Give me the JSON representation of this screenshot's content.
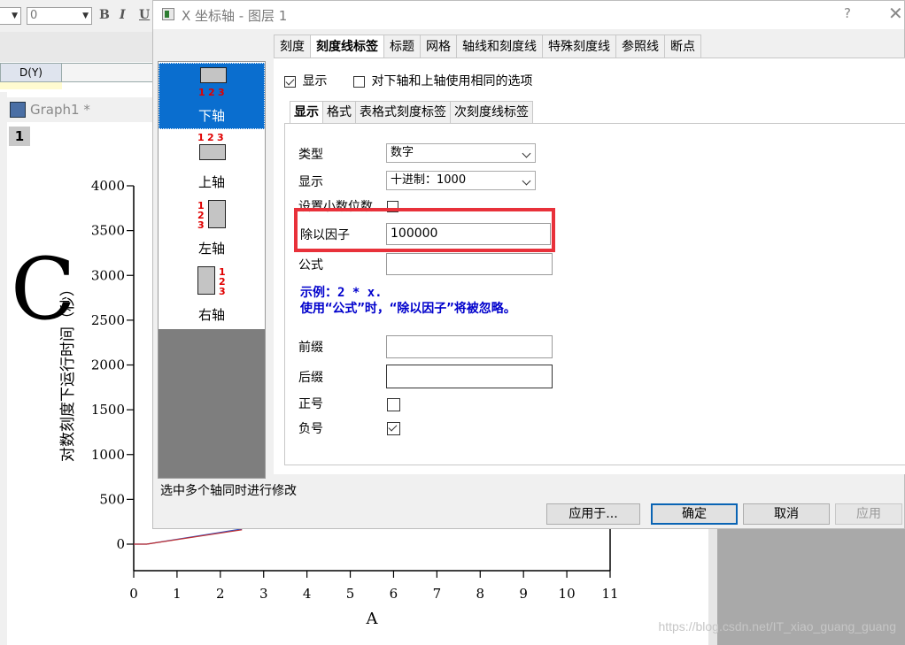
{
  "toolbar": {
    "font_size_value": "0",
    "bold_label": "B",
    "italic_label": "I",
    "underline_label": "U"
  },
  "worksheet": {
    "column_header": "D(Y)"
  },
  "graph_window": {
    "title": "Graph1 *",
    "layer_badge": "1"
  },
  "dialog": {
    "title": "X 坐标轴 - 图层 1",
    "help_label": "?",
    "close_label": "✕",
    "tabs": [
      "刻度",
      "刻度线标签",
      "标题",
      "网格",
      "轴线和刻度线",
      "特殊刻度线",
      "参照线",
      "断点"
    ],
    "active_tab": "刻度线标签",
    "side_items": [
      {
        "label": "下轴",
        "selected": true
      },
      {
        "label": "上轴",
        "selected": false
      },
      {
        "label": "左轴",
        "selected": false
      },
      {
        "label": "右轴",
        "selected": false
      }
    ],
    "axis_icon_numbers": [
      "1",
      "2",
      "3"
    ],
    "show_label": "显示",
    "show_checked": true,
    "same_options_label": "对下轴和上轴使用相同的选项",
    "same_options_checked": false,
    "inner_tabs": [
      "显示",
      "格式",
      "表格式刻度标签",
      "次刻度线标签"
    ],
    "active_inner_tab": "显示",
    "form": {
      "type_label": "类型",
      "type_value": "数字",
      "display_label": "显示",
      "display_value": "十进制：1000",
      "decimals_label": "设置小数位数",
      "divide_label": "除以因子",
      "divide_value": "100000",
      "formula_label": "公式",
      "formula_value": "",
      "example_line1": "示例：2 * x.",
      "example_line2": "使用“公式”时，“除以因子”将被忽略。",
      "prefix_label": "前缀",
      "suffix_label": "后缀",
      "plus_label": "正号",
      "minus_label": "负号",
      "plus_checked": false,
      "minus_checked": true
    },
    "status_text": "选中多个轴同时进行修改",
    "buttons": {
      "apply_to": "应用于...",
      "ok": "确定",
      "cancel": "取消",
      "apply": "应用"
    }
  },
  "chart_data": {
    "type": "line",
    "ylabel": "对数刻度下运行时间（秒）",
    "xlabel": "A",
    "big_letter": "C",
    "y_ticks": [
      "4000",
      "3500",
      "3000",
      "2500",
      "2000",
      "1500",
      "1000",
      "500",
      "0"
    ],
    "x_ticks": [
      "0",
      "1",
      "2",
      "3",
      "4",
      "5",
      "6",
      "7",
      "8",
      "9",
      "10",
      "11"
    ],
    "ylim": [
      0,
      4000
    ],
    "xlim": [
      0,
      11
    ],
    "series_visible": [
      {
        "color": "#3050c0",
        "x": [
          0,
          0.3,
          2.5
        ],
        "y": [
          0,
          0,
          170
        ]
      },
      {
        "color": "#c03030",
        "x": [
          0,
          0.3,
          2.5
        ],
        "y": [
          0,
          0,
          160
        ]
      }
    ]
  },
  "watermark": "https://blog.csdn.net/IT_xiao_guang_guang"
}
